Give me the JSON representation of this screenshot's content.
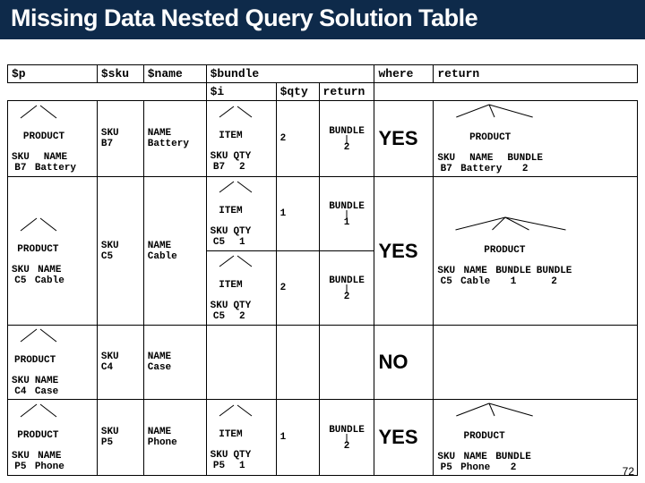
{
  "title": "Missing Data Nested Query Solution Table",
  "headers": {
    "p": "$p",
    "sku": "$sku",
    "name": "$name",
    "bundle": "$bundle",
    "i": "$i",
    "qty": "$qty",
    "return1": "return",
    "where": "where",
    "return2": "return"
  },
  "labels": {
    "product": "PRODUCT",
    "sku": "SKU",
    "name": "NAME",
    "item": "ITEM",
    "qty": "QTY",
    "bundle": "BUNDLE"
  },
  "yes": "YES",
  "no": "NO",
  "rows": [
    {
      "p": {
        "sku": "B7",
        "name": "Battery"
      },
      "sku": "B7",
      "name": "Battery",
      "items": [
        {
          "sku": "B7",
          "qty": "2"
        }
      ],
      "qtys": [
        "2"
      ],
      "bundles": [
        "2"
      ],
      "decision": "YES",
      "result": {
        "sku": "B7",
        "name": "Battery",
        "bundles": [
          "2"
        ]
      }
    },
    {
      "p": {
        "sku": "C5",
        "name": "Cable"
      },
      "sku": "C5",
      "name": "Cable",
      "items": [
        {
          "sku": "C5",
          "qty": "1"
        },
        {
          "sku": "C5",
          "qty": "2"
        }
      ],
      "qtys": [
        "1",
        "2"
      ],
      "bundles": [
        "1",
        "2"
      ],
      "decision": "YES",
      "result": {
        "sku": "C5",
        "name": "Cable",
        "bundles": [
          "1",
          "2"
        ]
      }
    },
    {
      "p": {
        "sku": "C4",
        "name": "Case"
      },
      "sku": "C4",
      "name": "Case",
      "items": [],
      "qtys": [],
      "bundles": [],
      "decision": "NO",
      "result": null
    },
    {
      "p": {
        "sku": "P5",
        "name": "Phone"
      },
      "sku": "P5",
      "name": "Phone",
      "items": [
        {
          "sku": "P5",
          "qty": "1"
        }
      ],
      "qtys": [
        "1"
      ],
      "bundles": [
        "2"
      ],
      "decision": "YES",
      "result": {
        "sku": "P5",
        "name": "Phone",
        "bundles": [
          "2"
        ]
      }
    }
  ],
  "pagenum": "72",
  "chart_data": {
    "type": "table",
    "title": "Missing Data Nested Query Solution Table",
    "columns": [
      "$p",
      "$sku",
      "$name",
      "$bundle.$i",
      "$bundle.$qty",
      "$bundle.return",
      "where",
      "return"
    ],
    "rows": [
      {
        "$p": "PRODUCT(SKU=B7, NAME=Battery)",
        "$sku": "SKU B7",
        "$name": "NAME Battery",
        "$bundle.$i": [
          "ITEM(SKU=B7, QTY=2)"
        ],
        "$bundle.$qty": [
          2
        ],
        "$bundle.return": [
          "BUNDLE 2"
        ],
        "where": "YES",
        "return": "PRODUCT(SKU=B7, NAME=Battery, BUNDLE=2)"
      },
      {
        "$p": "PRODUCT(SKU=C5, NAME=Cable)",
        "$sku": "SKU C5",
        "$name": "NAME Cable",
        "$bundle.$i": [
          "ITEM(SKU=C5, QTY=1)",
          "ITEM(SKU=C5, QTY=2)"
        ],
        "$bundle.$qty": [
          1,
          2
        ],
        "$bundle.return": [
          "BUNDLE 1",
          "BUNDLE 2"
        ],
        "where": "YES",
        "return": "PRODUCT(SKU=C5, NAME=Cable, BUNDLE=1, BUNDLE=2)"
      },
      {
        "$p": "PRODUCT(SKU=C4, NAME=Case)",
        "$sku": "SKU C4",
        "$name": "NAME Case",
        "$bundle.$i": [],
        "$bundle.$qty": [],
        "$bundle.return": [],
        "where": "NO",
        "return": null
      },
      {
        "$p": "PRODUCT(SKU=P5, NAME=Phone)",
        "$sku": "SKU P5",
        "$name": "NAME Phone",
        "$bundle.$i": [
          "ITEM(SKU=P5, QTY=1)"
        ],
        "$bundle.$qty": [
          1
        ],
        "$bundle.return": [
          "BUNDLE 2"
        ],
        "where": "YES",
        "return": "PRODUCT(SKU=P5, NAME=Phone, BUNDLE=2)"
      }
    ]
  }
}
